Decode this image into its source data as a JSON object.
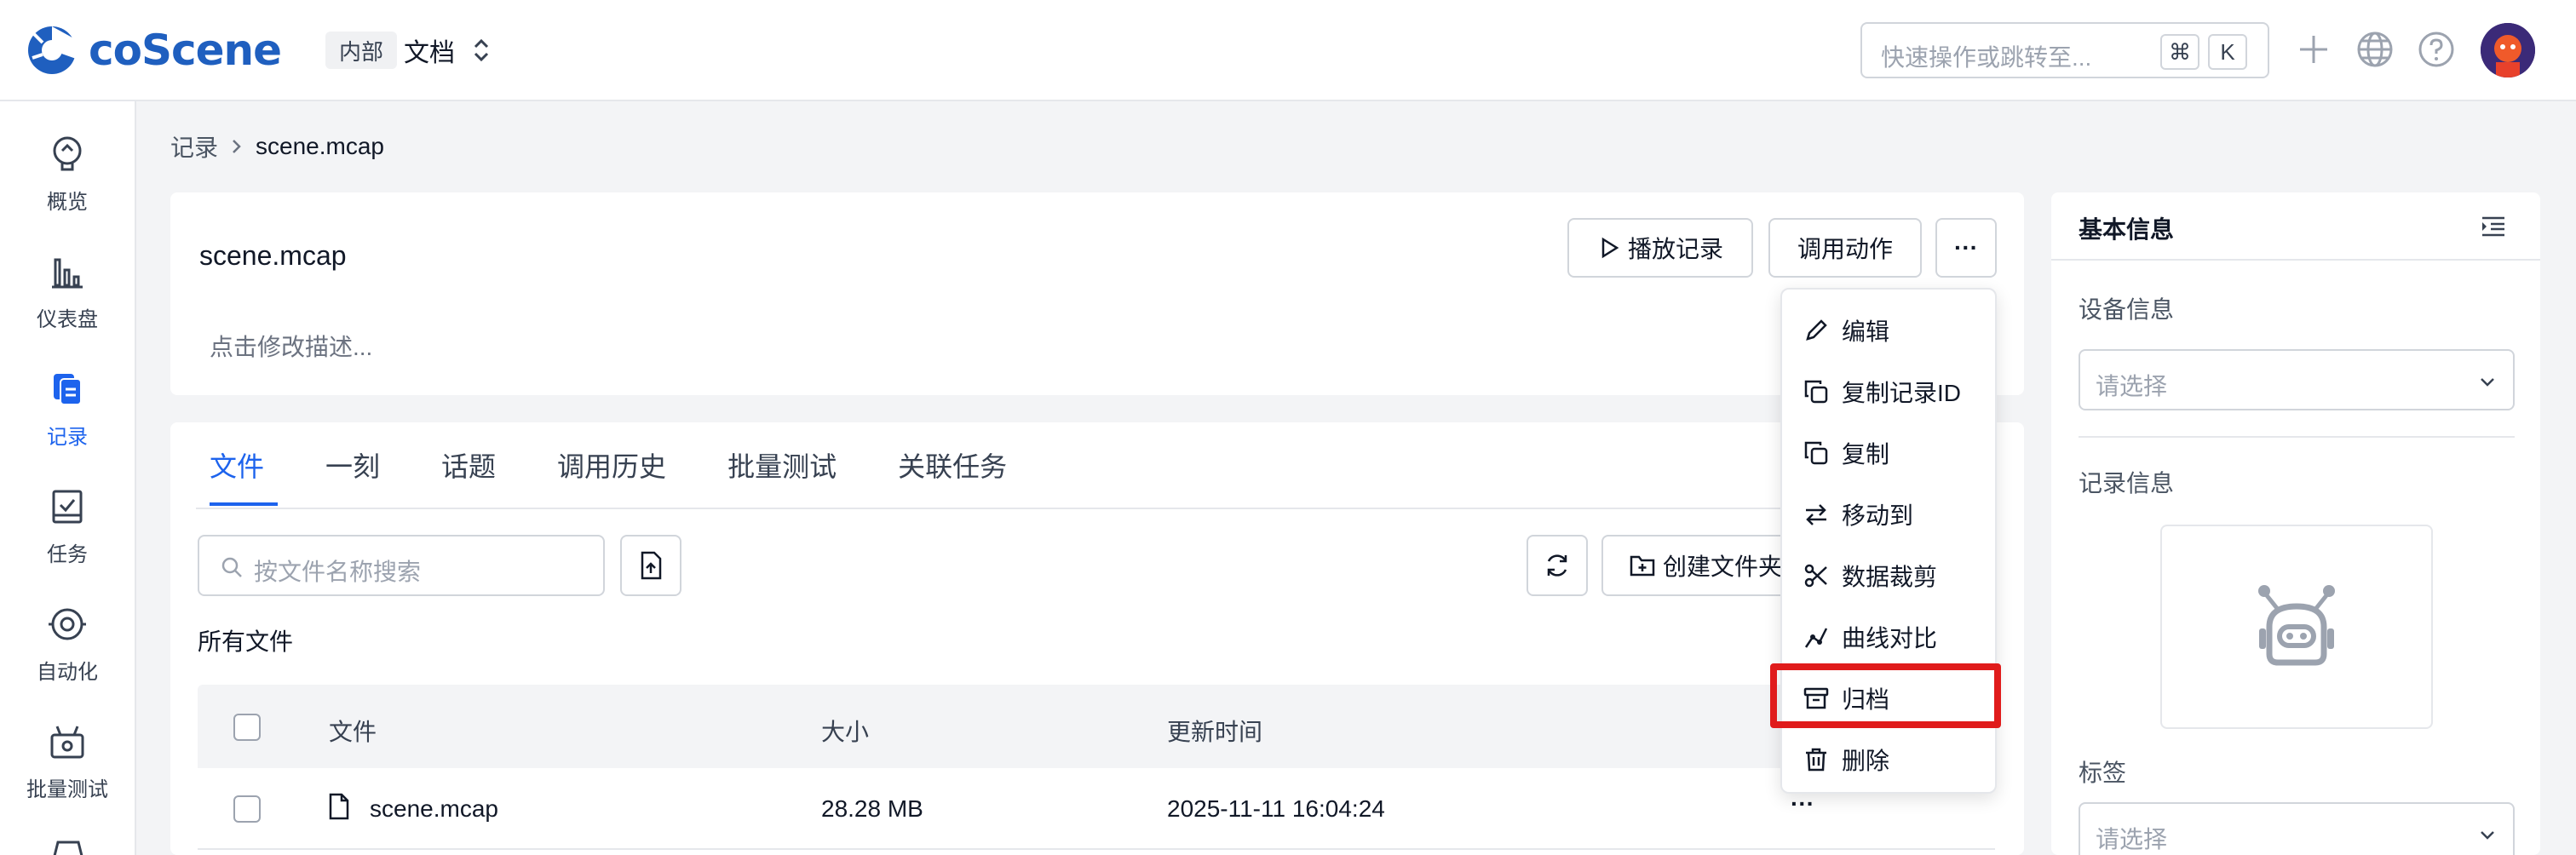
{
  "brand": {
    "name": "coScene",
    "color": "#1f5fbf"
  },
  "project": {
    "badge": "内部",
    "name": "文档"
  },
  "search": {
    "placeholder": "快速操作或跳转至...",
    "key1": "⌘",
    "key2": "K"
  },
  "top_icons": [
    "plus-icon",
    "globe-icon",
    "help-icon"
  ],
  "sidebar": {
    "items": [
      {
        "label": "概览",
        "icon": "overview-icon"
      },
      {
        "label": "仪表盘",
        "icon": "dashboard-icon"
      },
      {
        "label": "记录",
        "icon": "records-icon",
        "active": true
      },
      {
        "label": "任务",
        "icon": "tasks-icon"
      },
      {
        "label": "自动化",
        "icon": "automation-icon"
      },
      {
        "label": "批量测试",
        "icon": "batch-test-icon"
      }
    ]
  },
  "breadcrumb": {
    "root": "记录",
    "current": "scene.mcap"
  },
  "record": {
    "title": "scene.mcap",
    "description_placeholder": "点击修改描述...",
    "play_label": "播放记录",
    "invoke_label": "调用动作",
    "more_label": "···"
  },
  "tabs": [
    "文件",
    "一刻",
    "话题",
    "调用历史",
    "批量测试",
    "关联任务"
  ],
  "files": {
    "search_placeholder": "按文件名称搜索",
    "create_folder_label": "创建文件夹",
    "section_label": "所有文件",
    "columns": {
      "file": "文件",
      "size": "大小",
      "updated": "更新时间"
    },
    "rows": [
      {
        "name": "scene.mcap",
        "size": "28.28 MB",
        "updated": "2025-11-11 16:04:24",
        "more": "···"
      }
    ]
  },
  "menu": {
    "items": [
      {
        "label": "编辑",
        "icon": "edit-icon"
      },
      {
        "label": "复制记录ID",
        "icon": "copy-icon"
      },
      {
        "label": "复制",
        "icon": "copy-icon"
      },
      {
        "label": "移动到",
        "icon": "move-icon"
      },
      {
        "label": "数据裁剪",
        "icon": "scissors-icon"
      },
      {
        "label": "曲线对比",
        "icon": "curve-compare-icon"
      },
      {
        "label": "归档",
        "icon": "archive-icon",
        "highlighted": true
      },
      {
        "label": "删除",
        "icon": "trash-icon"
      }
    ],
    "highlight_color": "#e01b1b"
  },
  "right_panel": {
    "title": "基本信息",
    "device_label": "设备信息",
    "device_placeholder": "请选择",
    "record_info_label": "记录信息",
    "tags_label": "标签",
    "tags_placeholder": "请选择"
  },
  "colors": {
    "accent": "#1d63ed"
  }
}
